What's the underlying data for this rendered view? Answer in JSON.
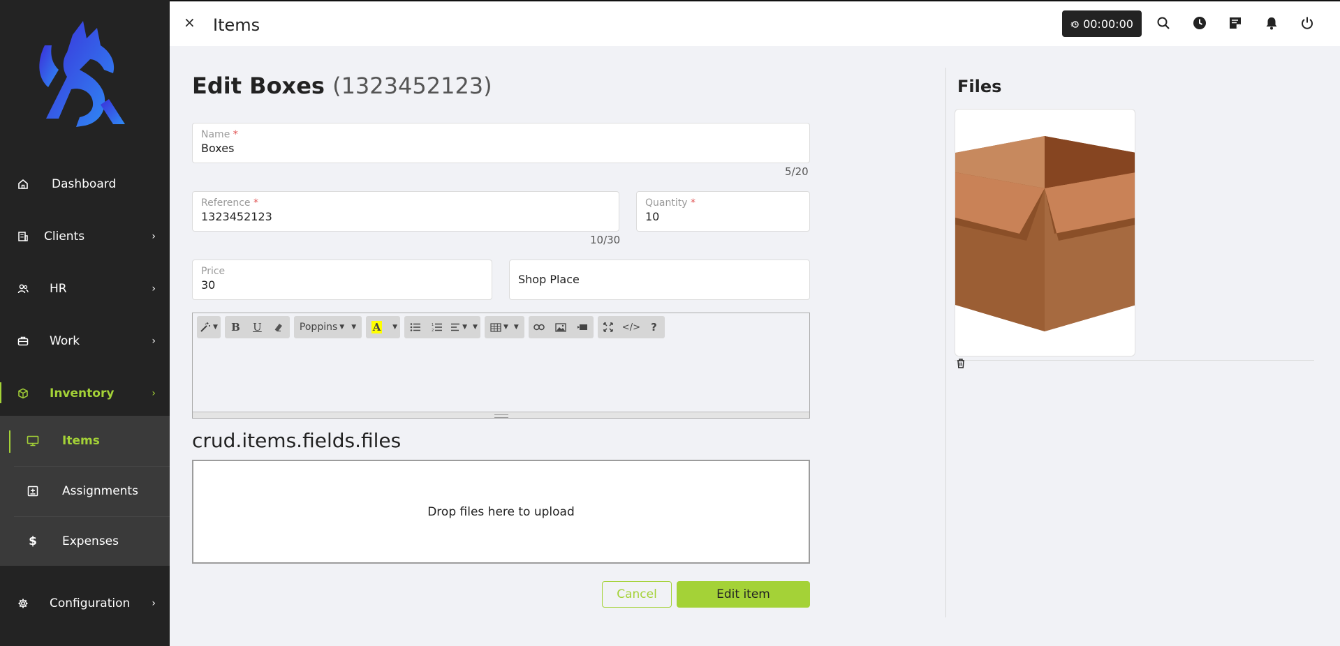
{
  "sidebar": {
    "items": [
      {
        "label": "Dashboard",
        "icon": "home-icon"
      },
      {
        "label": "Clients",
        "icon": "building-icon"
      },
      {
        "label": "HR",
        "icon": "users-icon"
      },
      {
        "label": "Work",
        "icon": "briefcase-icon"
      },
      {
        "label": "Inventory",
        "icon": "box-icon"
      },
      {
        "label": "Configuration",
        "icon": "gear-icon"
      }
    ],
    "submenu": [
      {
        "label": "Items",
        "icon": "monitor-icon"
      },
      {
        "label": "Assignments",
        "icon": "plus-square-icon"
      },
      {
        "label": "Expenses",
        "icon": "dollar-icon"
      }
    ],
    "accent_color": "#a4d237",
    "logo_color": "#3d5cf0"
  },
  "topbar": {
    "close": "×",
    "title": "Items",
    "timer": "00:00:00"
  },
  "form": {
    "title": "Edit Boxes",
    "title_ref": "(1323452123)",
    "name": {
      "label": "Name",
      "required": "*",
      "value": "Boxes",
      "counter": "5/20"
    },
    "reference": {
      "label": "Reference",
      "required": "*",
      "value": "1323452123",
      "counter": "10/30"
    },
    "quantity": {
      "label": "Quantity",
      "required": "*",
      "value": "10"
    },
    "price": {
      "label": "Price",
      "value": "30"
    },
    "shop_place": {
      "placeholder": "Shop Place"
    },
    "editor": {
      "font": "Poppins",
      "bold": "B",
      "underline": "U",
      "text_color": "A",
      "code": "</>",
      "help": "?"
    },
    "files_heading": "crud.items.fields.files",
    "dropzone_text": "Drop files here to upload",
    "cancel_label": "Cancel",
    "submit_label": "Edit item"
  },
  "files_panel": {
    "title": "Files"
  }
}
